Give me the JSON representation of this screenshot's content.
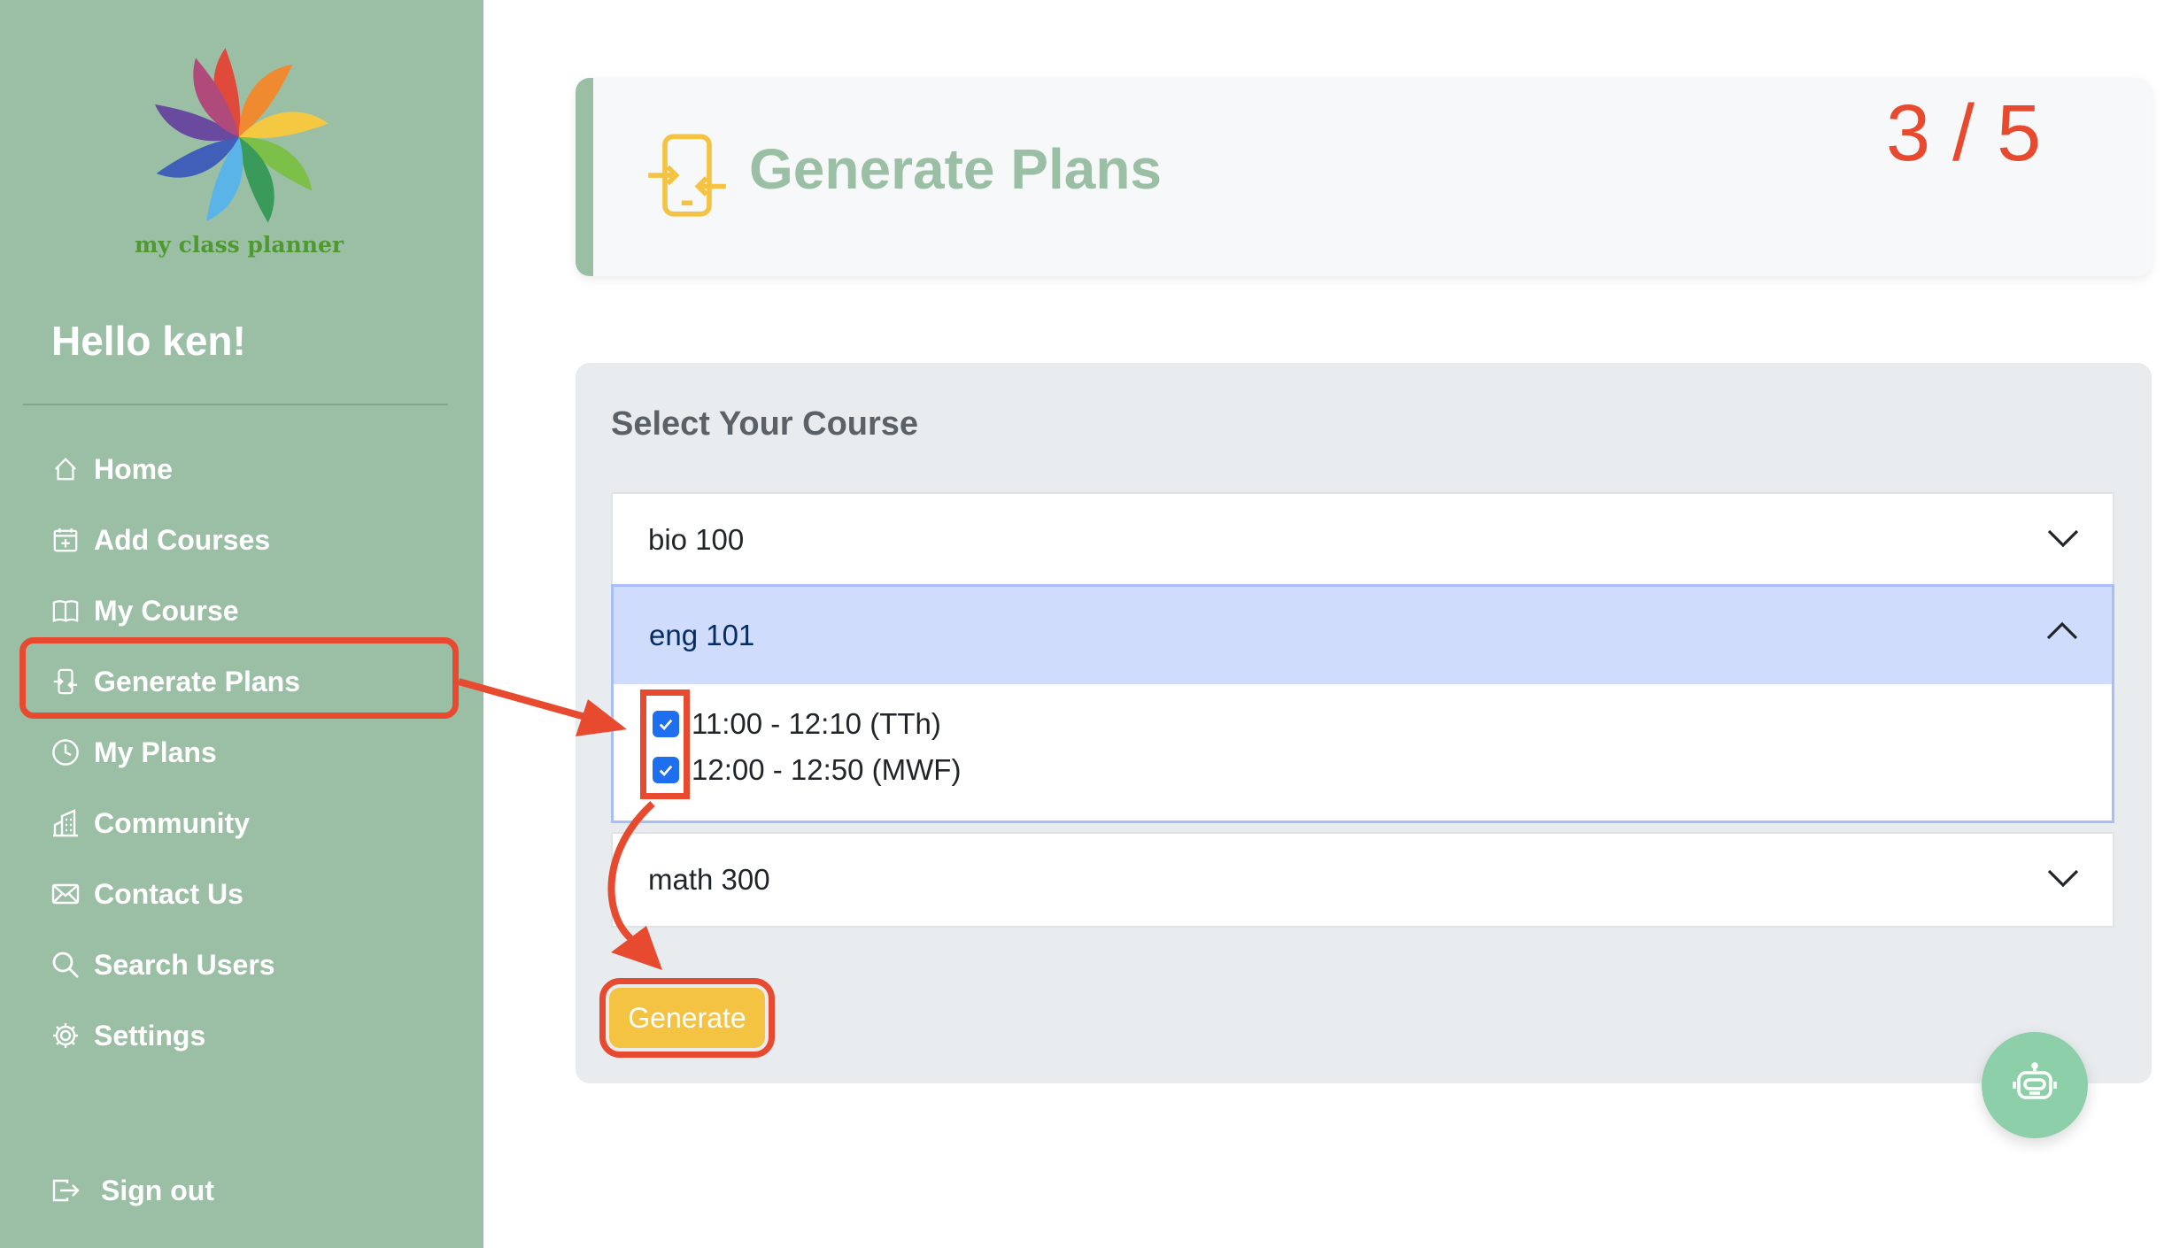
{
  "app": {
    "logo_text": "my class planner"
  },
  "sidebar": {
    "greeting": "Hello ken!",
    "items": [
      {
        "label": "Home",
        "icon": "home-icon"
      },
      {
        "label": "Add Courses",
        "icon": "calendar-plus-icon"
      },
      {
        "label": "My Course",
        "icon": "book-icon"
      },
      {
        "label": "Generate Plans",
        "icon": "phone-swap-icon"
      },
      {
        "label": "My Plans",
        "icon": "clock-icon"
      },
      {
        "label": "Community",
        "icon": "buildings-icon"
      },
      {
        "label": "Contact Us",
        "icon": "envelope-icon"
      },
      {
        "label": "Search Users",
        "icon": "search-icon"
      },
      {
        "label": "Settings",
        "icon": "gear-icon"
      }
    ],
    "signout": {
      "label": "Sign out",
      "icon": "box-arrow-right-icon"
    }
  },
  "header": {
    "title": "Generate Plans",
    "step": "3 / 5"
  },
  "courses": {
    "title": "Select Your Course",
    "items": [
      {
        "name": "bio 100",
        "expanded": false
      },
      {
        "name": "eng 101",
        "expanded": true,
        "options": [
          {
            "label": "11:00 - 12:10 (TTh)",
            "checked": true
          },
          {
            "label": "12:00 - 12:50 (MWF)",
            "checked": true
          }
        ]
      },
      {
        "name": "math 300",
        "expanded": false
      }
    ],
    "generate_label": "Generate"
  },
  "colors": {
    "sidebar": "#9abfa5",
    "accent": "#e84a2f",
    "button": "#f5c342",
    "checkbox": "#1e6ff0"
  }
}
